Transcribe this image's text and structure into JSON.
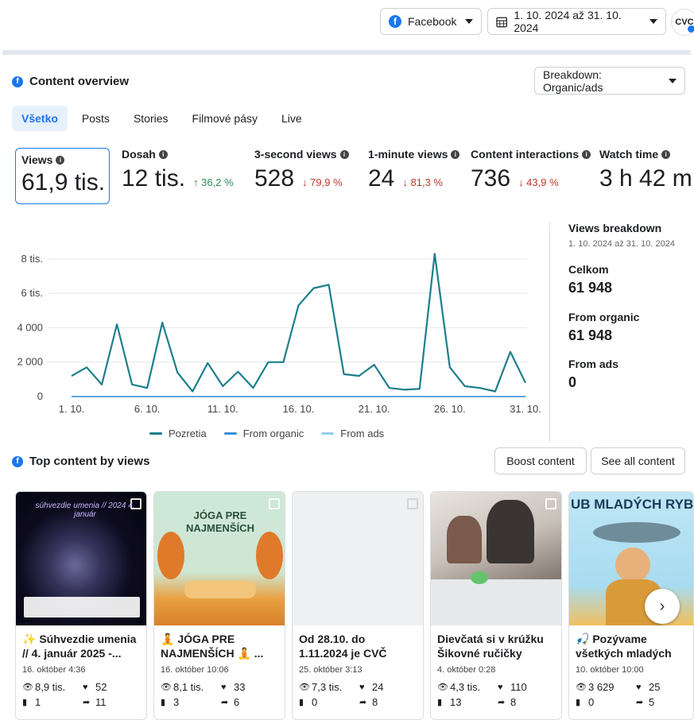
{
  "header": {
    "platform_label": "Facebook",
    "date_range": "1. 10. 2024 až 31. 10. 2024",
    "avatar_text": "CVC"
  },
  "overview": {
    "title": "Content overview",
    "breakdown_label": "Breakdown: Organic/ads",
    "tabs": [
      "Všetko",
      "Posts",
      "Stories",
      "Filmové pásy",
      "Live"
    ],
    "metrics": [
      {
        "label": "Views",
        "value": "61,9 tis.",
        "change": ""
      },
      {
        "label": "Dosah",
        "value": "12 tis.",
        "change": "↑ 36,2 %"
      },
      {
        "label": "3-second views",
        "value": "528",
        "change": "↓ 79,9 %"
      },
      {
        "label": "1-minute views",
        "value": "24",
        "change": "↓ 81,3 %"
      },
      {
        "label": "Content interactions",
        "value": "736",
        "change": "↓ 43,9 %"
      },
      {
        "label": "Watch time",
        "value": "3 h 42 m",
        "change": ""
      }
    ]
  },
  "chart_data": {
    "type": "line",
    "x": [
      "1. 10.",
      "2. 10.",
      "3. 10.",
      "4. 10.",
      "5. 10.",
      "6. 10.",
      "7. 10.",
      "8. 10.",
      "9. 10.",
      "10. 10.",
      "11. 10.",
      "12. 10.",
      "13. 10.",
      "14. 10.",
      "15. 10.",
      "16. 10.",
      "17. 10.",
      "18. 10.",
      "19. 10.",
      "20. 10.",
      "21. 10.",
      "22. 10.",
      "23. 10.",
      "24. 10.",
      "25. 10.",
      "26. 10.",
      "27. 10.",
      "28. 10.",
      "29. 10.",
      "30. 10.",
      "31. 10."
    ],
    "x_tick_labels": [
      "1. 10.",
      "6. 10.",
      "11. 10.",
      "16. 10.",
      "21. 10.",
      "26. 10.",
      "31. 10."
    ],
    "y_tick_labels": [
      "0",
      "2 000",
      "4 000",
      "6 tis.",
      "8 tis."
    ],
    "ylim": [
      0,
      8500
    ],
    "series": [
      {
        "name": "Pozretia",
        "color": "#1b7f8c",
        "values": [
          1200,
          1700,
          700,
          4200,
          700,
          500,
          4300,
          1400,
          300,
          1950,
          600,
          1450,
          500,
          2000,
          2000,
          5300,
          6300,
          6500,
          1300,
          1200,
          1850,
          500,
          400,
          450,
          8300,
          1700,
          600,
          500,
          300,
          2600,
          800
        ]
      },
      {
        "name": "From organic",
        "color": "#3b8ed8",
        "values": [
          0,
          0,
          0,
          0,
          0,
          0,
          0,
          0,
          0,
          0,
          0,
          0,
          0,
          0,
          0,
          0,
          0,
          0,
          0,
          0,
          0,
          0,
          0,
          0,
          0,
          0,
          0,
          0,
          0,
          0,
          0
        ]
      },
      {
        "name": "From ads",
        "color": "#8fd3f0",
        "values": [
          0,
          0,
          0,
          0,
          0,
          0,
          0,
          0,
          0,
          0,
          0,
          0,
          0,
          0,
          0,
          0,
          0,
          0,
          0,
          0,
          0,
          0,
          0,
          0,
          0,
          0,
          0,
          0,
          0,
          0,
          0
        ]
      }
    ],
    "grid": true
  },
  "views_breakdown": {
    "title": "Views breakdown",
    "date_range": "1. 10. 2024 až 31. 10. 2024",
    "total_label": "Celkom",
    "total_value": "61 948",
    "organic_label": "From organic",
    "organic_value": "61 948",
    "ads_label": "From ads",
    "ads_value": "0"
  },
  "top_content": {
    "title": "Top content by views",
    "boost_label": "Boost content",
    "see_all_label": "See all content",
    "cards": [
      {
        "title": "✨ Súhvezdie umenia // 4. január 2025 -...",
        "date": "16. október 4:36",
        "views": "8,9 tis.",
        "likes": "52",
        "comments": "1",
        "shares": "11",
        "thumb_text": "súhvezdie umenia // 2024 4. január"
      },
      {
        "title": "🧘 JÓGA PRE NAJMENŠÍCH 🧘 ...",
        "date": "16. október 10:06",
        "views": "8,1 tis.",
        "likes": "33",
        "comments": "3",
        "shares": "6",
        "thumb_text": "JÓGA PRE NAJMENŠÍCH"
      },
      {
        "title": "Od 28.10. do 1.11.2024 je CVČ ZATVORENÉ ...",
        "date": "25. október 3:13",
        "views": "7,3 tis.",
        "likes": "24",
        "comments": "0",
        "shares": "8",
        "thumb_text": ""
      },
      {
        "title": "Dievčatá si v krúžku Šikovné ručičky začal...",
        "date": "4. október 0:28",
        "views": "4,3 tis.",
        "likes": "110",
        "comments": "13",
        "shares": "8",
        "thumb_text": ""
      },
      {
        "title": "🎣 Pozývame všetkých mladých rybárov! 🎣 ...",
        "date": "10. október 10:00",
        "views": "3 629",
        "likes": "25",
        "comments": "0",
        "shares": "5",
        "thumb_text": "UB MLADÝCH RYB"
      }
    ]
  }
}
